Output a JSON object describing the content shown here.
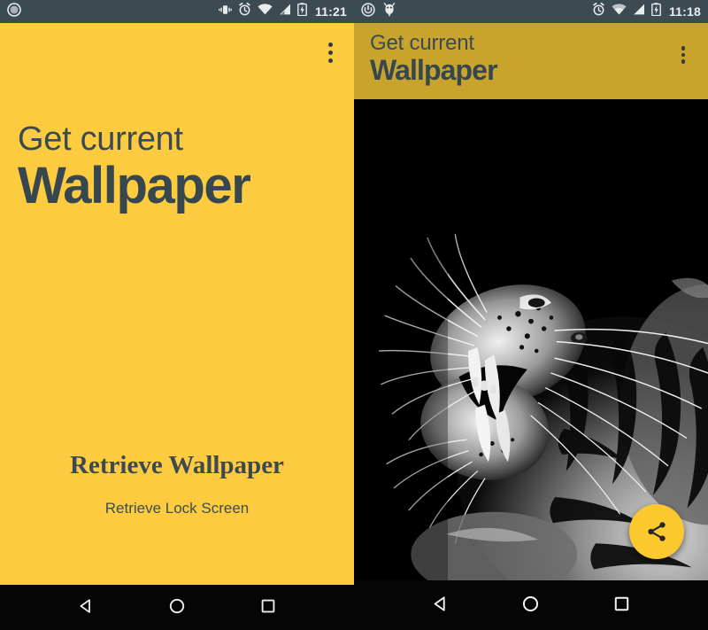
{
  "left_screen": {
    "status_bar": {
      "time": "11:21",
      "notification_icons": [
        "circle-notification-icon"
      ],
      "system_icons": [
        "vibrate-icon",
        "alarm-icon",
        "wifi-icon",
        "signal-icon",
        "battery-charging-icon"
      ],
      "background_color": "#3C4A52"
    },
    "overflow_menu_label": "more-options",
    "title_line1": "Get current",
    "title_line2": "Wallpaper",
    "primary_button": "Retrieve Wallpaper",
    "secondary_button": "Retrieve Lock Screen",
    "background_color": "#FCCB3F",
    "text_color": "#37474F"
  },
  "right_screen": {
    "status_bar": {
      "time": "11:18",
      "notification_icons": [
        "power-sync-icon",
        "bug-icon"
      ],
      "system_icons": [
        "alarm-icon",
        "wifi-icon",
        "signal-icon",
        "battery-charging-icon"
      ],
      "background_color": "#3C4A52"
    },
    "app_bar": {
      "title_line1": "Get current",
      "title_line2": "Wallpaper",
      "overflow_menu_label": "more-options",
      "background_color": "#C9A42C"
    },
    "wallpaper": {
      "description": "Black and white photograph of a roaring tiger",
      "background_color": "#000000"
    },
    "fab": {
      "icon": "share-icon",
      "label": "Share",
      "color": "#FBC82E"
    }
  },
  "nav_bar": {
    "buttons": [
      {
        "name": "back",
        "icon": "back-triangle-icon"
      },
      {
        "name": "home",
        "icon": "home-circle-icon"
      },
      {
        "name": "recents",
        "icon": "recents-square-icon"
      }
    ],
    "background_color": "#050505"
  }
}
